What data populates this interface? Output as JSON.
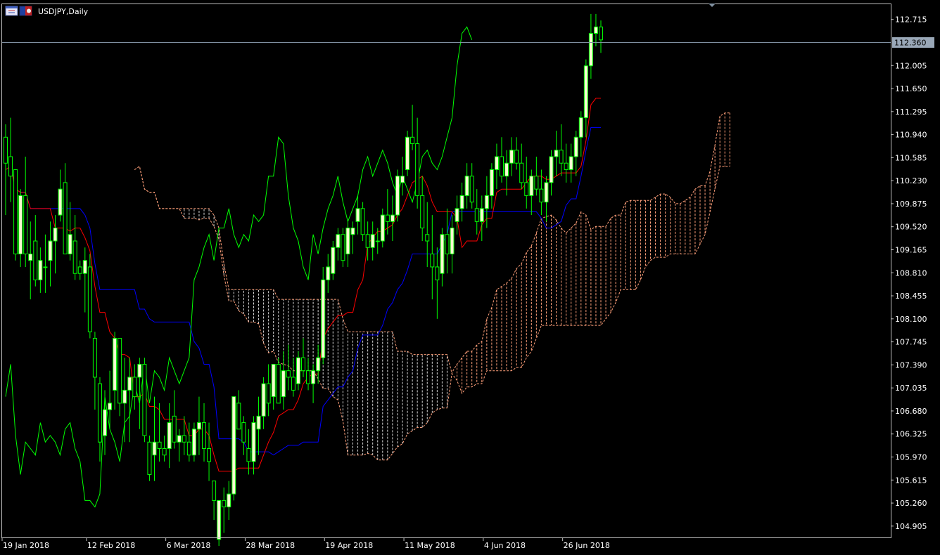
{
  "window": {
    "symbol_title": "USDJPY,Daily"
  },
  "icons": {
    "chart": "chart-window-icon",
    "flag": "symbol-flag-icon"
  },
  "colors": {
    "background": "#000000",
    "frame": "#c0c0c0",
    "bull_body": "#fafad2",
    "bear_body": "#000000",
    "candle_outline": "#00ff00",
    "tenkan": "#ff0000",
    "kijun": "#0000ff",
    "chikou": "#00ff00",
    "cloud_up": "#ffa07a",
    "cloud_down": "#d8d8d8",
    "price_line": "#7f8fa0",
    "price_tag_bg": "#9aa8b8"
  },
  "current_price": {
    "value": 112.36,
    "label": "112.360"
  },
  "chart_data": {
    "type": "candlestick",
    "title": "USDJPY,Daily",
    "ylim": [
      104.73,
      112.95
    ],
    "y_ticks": [
      "112.715",
      "112.005",
      "111.650",
      "111.295",
      "110.940",
      "110.585",
      "110.230",
      "109.875",
      "109.520",
      "109.165",
      "108.810",
      "108.455",
      "108.100",
      "107.745",
      "107.390",
      "107.035",
      "106.680",
      "106.325",
      "105.970",
      "105.615",
      "105.260",
      "104.905"
    ],
    "x_ticks": [
      {
        "index": 0,
        "label": "19 Jan 2018"
      },
      {
        "index": 17,
        "label": "12 Feb 2018"
      },
      {
        "index": 33,
        "label": "6 Mar 2018"
      },
      {
        "index": 49,
        "label": "28 Mar 2018"
      },
      {
        "index": 65,
        "label": "19 Apr 2018"
      },
      {
        "index": 81,
        "label": "11 May 2018"
      },
      {
        "index": 97,
        "label": "4 Jun 2018"
      },
      {
        "index": 113,
        "label": "26 Jun 2018"
      }
    ],
    "candles": [
      [
        110.9,
        111.1,
        109.7,
        110.5
      ],
      [
        110.6,
        111.2,
        109.9,
        110.3
      ],
      [
        110.4,
        110.4,
        109.0,
        109.1
      ],
      [
        109.1,
        110.1,
        108.9,
        110.0
      ],
      [
        110.0,
        110.6,
        108.9,
        109.1
      ],
      [
        109.0,
        109.6,
        108.4,
        109.1
      ],
      [
        109.3,
        109.7,
        108.6,
        108.7
      ],
      [
        108.7,
        109.2,
        108.5,
        109.0
      ],
      [
        108.9,
        109.4,
        108.5,
        108.9
      ],
      [
        109.0,
        109.6,
        108.6,
        109.3
      ],
      [
        109.3,
        109.7,
        108.8,
        109.5
      ],
      [
        109.7,
        110.4,
        109.6,
        110.1
      ],
      [
        110.2,
        110.5,
        109.1,
        109.1
      ],
      [
        109.1,
        109.9,
        109.0,
        109.4
      ],
      [
        109.3,
        109.7,
        108.7,
        108.8
      ],
      [
        108.9,
        109.0,
        108.7,
        108.8
      ],
      [
        108.8,
        109.2,
        108.2,
        109.0
      ],
      [
        108.9,
        109.1,
        107.8,
        107.9
      ],
      [
        107.8,
        107.9,
        106.7,
        107.2
      ],
      [
        107.1,
        107.2,
        105.9,
        106.2
      ],
      [
        106.3,
        107.0,
        106.0,
        106.7
      ],
      [
        106.7,
        107.3,
        106.4,
        106.8
      ],
      [
        107.0,
        107.9,
        106.7,
        107.8
      ],
      [
        107.8,
        107.8,
        106.6,
        106.8
      ],
      [
        106.8,
        107.5,
        106.2,
        107.0
      ],
      [
        107.0,
        107.5,
        106.2,
        107.2
      ],
      [
        107.2,
        107.4,
        106.7,
        106.9
      ],
      [
        107.2,
        107.5,
        106.4,
        107.4
      ],
      [
        107.4,
        107.5,
        106.2,
        106.3
      ],
      [
        106.2,
        106.3,
        105.6,
        105.7
      ],
      [
        106.0,
        106.9,
        105.6,
        106.2
      ],
      [
        106.2,
        106.8,
        105.9,
        106.1
      ],
      [
        106.1,
        106.3,
        105.9,
        106.0
      ],
      [
        106.1,
        106.8,
        105.8,
        106.5
      ],
      [
        106.6,
        107.0,
        106.1,
        106.2
      ],
      [
        106.2,
        106.4,
        105.9,
        106.3
      ],
      [
        106.3,
        106.6,
        106.0,
        106.2
      ],
      [
        106.2,
        106.5,
        105.9,
        106.0
      ],
      [
        106.0,
        106.5,
        105.9,
        106.4
      ],
      [
        106.4,
        106.9,
        106.0,
        106.5
      ],
      [
        106.5,
        106.8,
        105.9,
        106.1
      ],
      [
        106.1,
        106.5,
        105.6,
        105.9
      ],
      [
        105.6,
        105.6,
        105.0,
        105.3
      ],
      [
        104.7,
        105.3,
        104.6,
        105.3
      ],
      [
        105.3,
        105.5,
        104.8,
        105.2
      ],
      [
        105.2,
        105.6,
        105.0,
        105.4
      ],
      [
        105.4,
        106.9,
        105.3,
        106.9
      ],
      [
        106.8,
        107.0,
        106.4,
        106.4
      ],
      [
        106.5,
        106.6,
        106.0,
        106.2
      ],
      [
        106.1,
        106.4,
        105.7,
        105.9
      ],
      [
        105.9,
        106.6,
        105.7,
        106.5
      ],
      [
        106.4,
        106.9,
        106.0,
        106.6
      ],
      [
        106.6,
        107.2,
        106.4,
        107.1
      ],
      [
        107.1,
        107.4,
        106.6,
        106.8
      ],
      [
        106.9,
        107.4,
        106.7,
        107.4
      ],
      [
        107.4,
        107.5,
        106.8,
        106.8
      ],
      [
        106.9,
        107.6,
        106.7,
        107.3
      ],
      [
        107.3,
        107.7,
        107.0,
        107.2
      ],
      [
        107.2,
        107.5,
        106.9,
        107.0
      ],
      [
        107.1,
        107.6,
        107.0,
        107.5
      ],
      [
        107.5,
        107.8,
        107.2,
        107.3
      ],
      [
        107.3,
        107.5,
        107.0,
        107.1
      ],
      [
        107.1,
        107.4,
        106.8,
        107.3
      ],
      [
        107.3,
        107.7,
        107.1,
        107.5
      ],
      [
        107.5,
        108.9,
        107.4,
        108.7
      ],
      [
        108.7,
        109.1,
        108.5,
        108.9
      ],
      [
        108.8,
        109.3,
        108.7,
        109.2
      ],
      [
        109.2,
        109.5,
        109.0,
        109.4
      ],
      [
        109.4,
        109.5,
        108.9,
        109.0
      ],
      [
        109.1,
        109.6,
        108.9,
        109.5
      ],
      [
        109.4,
        109.6,
        109.1,
        109.5
      ],
      [
        109.6,
        110.0,
        109.4,
        109.8
      ],
      [
        109.8,
        109.9,
        109.3,
        109.4
      ],
      [
        109.4,
        109.6,
        109.0,
        109.2
      ],
      [
        109.2,
        109.6,
        109.0,
        109.4
      ],
      [
        109.3,
        109.5,
        109.1,
        109.3
      ],
      [
        109.3,
        109.8,
        109.2,
        109.7
      ],
      [
        109.7,
        110.1,
        109.4,
        109.6
      ],
      [
        109.6,
        110.0,
        109.3,
        109.7
      ],
      [
        109.7,
        110.4,
        109.6,
        110.3
      ],
      [
        110.2,
        110.6,
        110.0,
        110.3
      ],
      [
        110.4,
        111.0,
        110.3,
        110.9
      ],
      [
        110.9,
        111.4,
        110.7,
        110.8
      ],
      [
        110.8,
        111.2,
        109.8,
        110.0
      ],
      [
        110.0,
        110.3,
        109.3,
        109.5
      ],
      [
        109.4,
        109.9,
        108.9,
        109.3
      ],
      [
        109.1,
        109.7,
        108.4,
        108.9
      ],
      [
        108.9,
        109.2,
        108.1,
        108.7
      ],
      [
        108.8,
        109.5,
        108.6,
        109.4
      ],
      [
        109.4,
        109.8,
        108.8,
        109.1
      ],
      [
        109.1,
        109.7,
        108.8,
        109.5
      ],
      [
        109.6,
        110.0,
        109.4,
        109.8
      ],
      [
        109.8,
        110.2,
        109.6,
        110.0
      ],
      [
        110.0,
        110.5,
        109.8,
        110.3
      ],
      [
        110.3,
        110.5,
        109.8,
        109.9
      ],
      [
        109.8,
        110.1,
        109.4,
        109.6
      ],
      [
        109.6,
        110.0,
        109.3,
        109.8
      ],
      [
        109.8,
        110.3,
        109.5,
        110.0
      ],
      [
        110.0,
        110.5,
        109.8,
        110.4
      ],
      [
        110.4,
        110.8,
        110.1,
        110.6
      ],
      [
        110.6,
        110.9,
        110.2,
        110.3
      ],
      [
        110.3,
        110.7,
        110.0,
        110.5
      ],
      [
        110.5,
        110.9,
        110.3,
        110.7
      ],
      [
        110.7,
        110.9,
        110.4,
        110.5
      ],
      [
        110.5,
        110.8,
        110.1,
        110.2
      ],
      [
        110.2,
        110.6,
        109.8,
        110.0
      ],
      [
        110.0,
        110.4,
        109.7,
        110.3
      ],
      [
        110.3,
        110.6,
        110.0,
        110.1
      ],
      [
        110.1,
        110.4,
        109.7,
        109.9
      ],
      [
        109.9,
        110.3,
        109.6,
        110.2
      ],
      [
        110.2,
        110.7,
        110.0,
        110.6
      ],
      [
        110.6,
        111.0,
        110.3,
        110.7
      ],
      [
        110.7,
        111.1,
        110.3,
        110.5
      ],
      [
        110.5,
        110.8,
        110.2,
        110.4
      ],
      [
        110.4,
        110.8,
        110.2,
        110.6
      ],
      [
        110.6,
        111.0,
        110.3,
        110.9
      ],
      [
        110.9,
        111.3,
        110.6,
        111.2
      ],
      [
        111.2,
        112.1,
        110.9,
        112.0
      ],
      [
        112.0,
        112.8,
        111.8,
        112.5
      ],
      [
        112.5,
        112.8,
        112.3,
        112.6
      ],
      [
        112.6,
        112.7,
        112.2,
        112.4
      ]
    ]
  }
}
